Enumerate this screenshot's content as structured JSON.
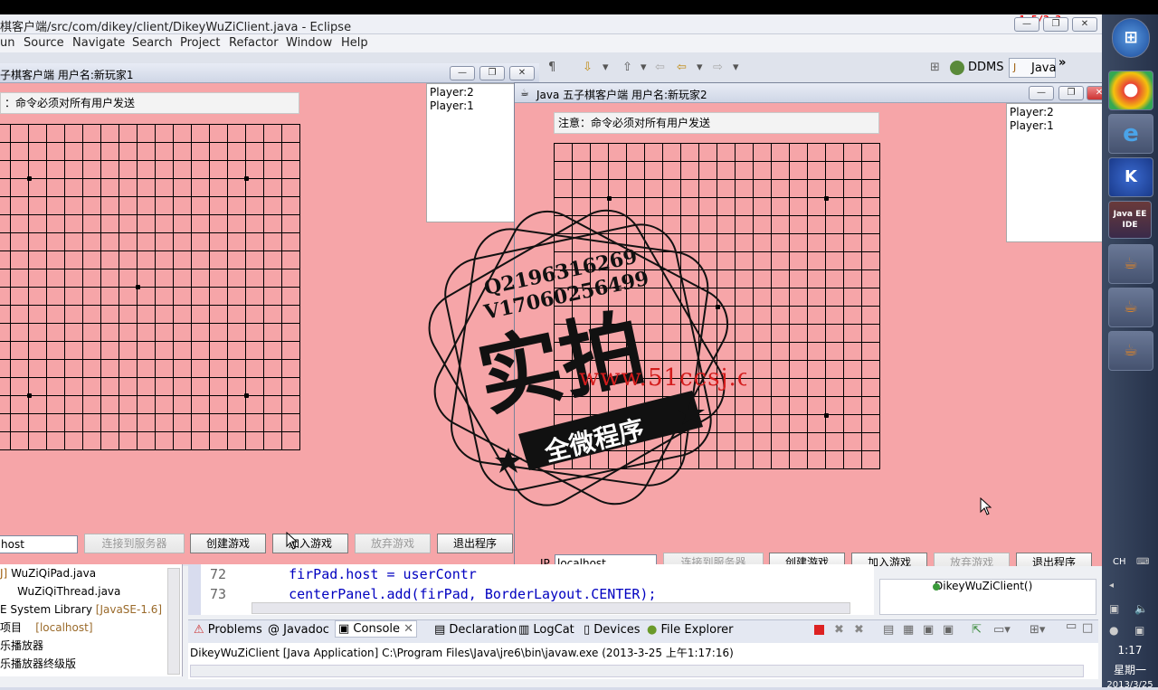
{
  "eclipse": {
    "title": "棋客户端/src/com/dikey/client/DikeyWuZiClient.java - Eclipse",
    "corner_text": "1:5/2:3",
    "menu": [
      "un",
      "Source",
      "Navigate",
      "Search",
      "Project",
      "Refactor",
      "Window",
      "Help"
    ],
    "perspectives": {
      "ddms": "DDMS",
      "java": "Java"
    }
  },
  "window1": {
    "title": "子棋客户端 用户名:新玩家1",
    "notice": "：命令必须对所有用户发送",
    "players": [
      "Player:2",
      "Player:1"
    ],
    "ip_value": "host",
    "buttons": {
      "connect": "连接到服务器",
      "create": "创建游戏",
      "join": "加入游戏",
      "give_up": "放弃游戏",
      "exit": "退出程序"
    }
  },
  "window2": {
    "title": "Java 五子棋客户端 用户名:新玩家2",
    "notice": "注意：命令必须对所有用户发送",
    "players": [
      "Player:2",
      "Player:1"
    ],
    "ip_label": "IP",
    "ip_value": "localhost",
    "buttons": {
      "connect": "连接到服务器",
      "create": "创建游戏",
      "join": "加入游戏",
      "give_up": "放弃游戏",
      "exit": "退出程序"
    }
  },
  "explorer": {
    "items": [
      "WuZiQiPad.java",
      "WuZiQiThread.java",
      "System Library",
      "[JavaSE-1.6]",
      "项目",
      "[localhost]",
      "乐播放器",
      "乐播放器终级版"
    ]
  },
  "editor": {
    "lines": [
      {
        "num": "72",
        "code": "firPad.host = userContr"
      },
      {
        "num": "73",
        "code": "centerPanel.add(firPad, BorderLayout.CENTER);"
      }
    ]
  },
  "outline": {
    "item": "DikeyWuZiClient()"
  },
  "console": {
    "tabs": [
      "Problems",
      "Javadoc",
      "Console",
      "Declaration",
      "LogCat",
      "Devices",
      "File Explorer"
    ],
    "status": "DikeyWuZiClient [Java Application] C:\\Program Files\\Java\\jre6\\bin\\javaw.exe (2013-3-25 上午1:17:16)"
  },
  "taskbar": {
    "lang": "CH",
    "time": "1:17",
    "weekday": "星期一",
    "date": "2013/3/25"
  },
  "watermark": {
    "qq": "Q2196316269",
    "vx": "V17060256499",
    "main": "实拍",
    "banner": "全微程序",
    "site": "www.51ccsj.com"
  },
  "colors": {
    "window_bg": "#f6a5a8",
    "grid": "#000000",
    "desktop": "#dfe3ec"
  }
}
